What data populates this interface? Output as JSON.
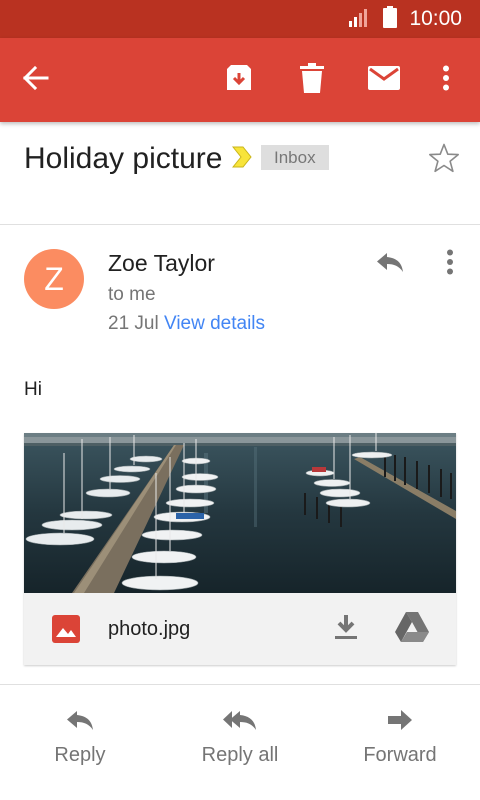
{
  "status_bar": {
    "time": "10:00",
    "signal_icon": "signal-icon",
    "battery_icon": "battery-icon",
    "background": "#b93221"
  },
  "app_bar": {
    "background": "#db4437",
    "back_icon": "arrow-back-icon",
    "archive_icon": "archive-icon",
    "delete_icon": "delete-icon",
    "mark_unread_icon": "mail-icon",
    "more_icon": "more-vert-icon"
  },
  "email": {
    "subject": "Holiday picture",
    "label": "Inbox",
    "important_icon": "important-marker-icon",
    "star_icon": "star-outline-icon"
  },
  "message": {
    "sender_initial": "Z",
    "sender_name": "Zoe Taylor",
    "recipient": "to me",
    "date": "21 Jul",
    "view_details": "View details",
    "avatar_color": "#fb8c61",
    "body": "Hi"
  },
  "attachment": {
    "file_name": "photo.jpg",
    "file_icon": "image-icon",
    "download_icon": "download-icon",
    "drive_icon": "google-drive-icon"
  },
  "footer": {
    "reply_label": "Reply",
    "reply_all_label": "Reply all",
    "forward_label": "Forward"
  },
  "colors": {
    "accent": "#db4437",
    "link": "#4285f4",
    "muted_text": "#757575"
  }
}
